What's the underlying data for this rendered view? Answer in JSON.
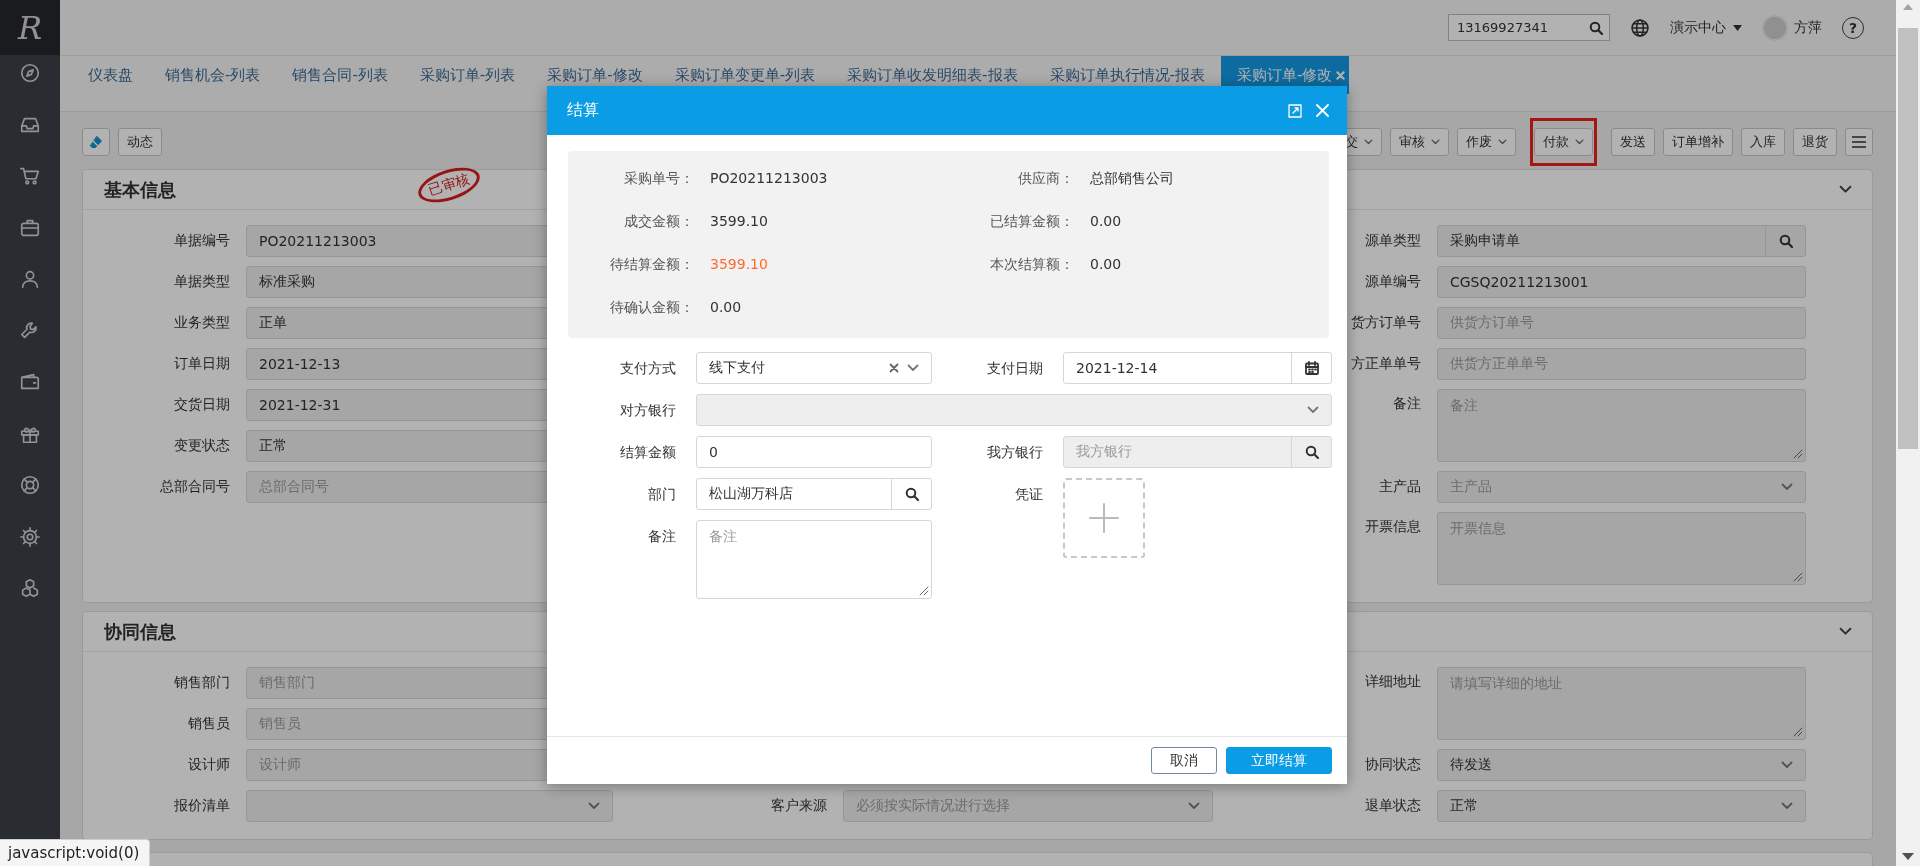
{
  "sidebar": {
    "logo": "R"
  },
  "top_bar": {
    "search": {
      "value": "13169927341"
    },
    "organization": "演示中心",
    "user_name": "方萍",
    "help": "?"
  },
  "tabs": [
    {
      "label": "仪表盘",
      "selected": false
    },
    {
      "label": "销售机会-列表",
      "selected": false
    },
    {
      "label": "销售合同-列表",
      "selected": false
    },
    {
      "label": "采购订单-列表",
      "selected": false
    },
    {
      "label": "采购订单-修改",
      "selected": false
    },
    {
      "label": "采购订单变更单-列表",
      "selected": false
    },
    {
      "label": "采购订单收发明细表-报表",
      "selected": false
    },
    {
      "label": "采购订单执行情况-报表",
      "selected": false
    },
    {
      "label": "采购订单-修改",
      "selected": true
    }
  ],
  "toolbar": {
    "left_buttons": [
      {
        "kind": "icon"
      },
      {
        "kind": "text",
        "label": "动态"
      }
    ],
    "right_buttons": [
      {
        "label": "交",
        "dropdown": true,
        "highlighted": false
      },
      {
        "label": "审核",
        "dropdown": true,
        "highlighted": false
      },
      {
        "label": "作废",
        "dropdown": true,
        "highlighted": false
      },
      {
        "label": "付款",
        "dropdown": true,
        "highlighted": true
      },
      {
        "label": "发送",
        "dropdown": false,
        "highlighted": false
      },
      {
        "label": "订单增补",
        "dropdown": false,
        "highlighted": false
      },
      {
        "label": "入库",
        "dropdown": false,
        "highlighted": false
      },
      {
        "label": "退货",
        "dropdown": false,
        "highlighted": false
      }
    ]
  },
  "basic_info": {
    "title": "基本信息",
    "stamp": "已审核",
    "left_fields": [
      {
        "label": "单据编号",
        "kind": "text",
        "value": "PO20211213003"
      },
      {
        "label": "单据类型",
        "kind": "text",
        "value": "标准采购"
      },
      {
        "label": "业务类型",
        "kind": "text",
        "value": "正单"
      },
      {
        "label": "订单日期",
        "kind": "text",
        "value": "2021-12-13"
      },
      {
        "label": "交货日期",
        "kind": "text",
        "value": "2021-12-31"
      },
      {
        "label": "变更状态",
        "kind": "text",
        "value": "正常"
      },
      {
        "label": "总部合同号",
        "kind": "text",
        "placeholder": "总部合同号"
      }
    ],
    "right_fields": [
      {
        "label": "源单类型",
        "kind": "search",
        "value": "采购申请单"
      },
      {
        "label": "源单编号",
        "kind": "text",
        "value": "CGSQ20211213001"
      },
      {
        "label": "货方订单号",
        "kind": "text",
        "placeholder": "供货方订单号"
      },
      {
        "label": "方正单单号",
        "kind": "text",
        "placeholder": "供货方正单单号"
      },
      {
        "label": "备注",
        "kind": "textarea",
        "placeholder": "备注"
      },
      {
        "label": "主产品",
        "kind": "select",
        "placeholder": "主产品"
      },
      {
        "label": "开票信息",
        "kind": "textarea",
        "placeholder": "开票信息"
      }
    ]
  },
  "collaboration": {
    "title": "协同信息",
    "left_fields": [
      {
        "label": "销售部门",
        "kind": "text",
        "placeholder": "销售部门"
      },
      {
        "label": "销售员",
        "kind": "text",
        "placeholder": "销售员"
      },
      {
        "label": "设计师",
        "kind": "text",
        "placeholder": "设计师"
      },
      {
        "label": "报价清单",
        "kind": "select"
      }
    ],
    "middle_fields": [
      {
        "label": "客户来源",
        "kind": "select",
        "placeholder": "必须按实际情况进行选择"
      }
    ],
    "right_fields": [
      {
        "label": "详细地址",
        "kind": "textarea",
        "placeholder": "请填写详细的地址"
      },
      {
        "label": "协同状态",
        "kind": "select",
        "value": "待发送"
      },
      {
        "label": "退单状态",
        "kind": "select",
        "value": "正常"
      }
    ]
  },
  "dialog": {
    "title": "结算",
    "summary": [
      {
        "label": "采购单号：",
        "value": "PO20211213003",
        "highlight": false
      },
      {
        "label": "供应商：",
        "value": "总部销售公司",
        "highlight": false
      },
      {
        "label": "成交金额：",
        "value": "3599.10",
        "highlight": false
      },
      {
        "label": "已结算金额：",
        "value": "0.00",
        "highlight": false
      },
      {
        "label": "待结算金额：",
        "value": "3599.10",
        "highlight": true
      },
      {
        "label": "本次结算额：",
        "value": "0.00",
        "highlight": false
      },
      {
        "label": "待确认金额：",
        "value": "0.00",
        "highlight": false
      }
    ],
    "form": [
      {
        "label": "支付方式",
        "kind": "select",
        "value": "线下支付",
        "clearable": true,
        "disabled": false
      },
      {
        "label": "支付日期",
        "kind": "date",
        "value": "2021-12-14",
        "disabled": false
      },
      {
        "label": "对方银行",
        "kind": "select",
        "wide": true,
        "disabled": true
      },
      {
        "label": "结算金额",
        "kind": "text",
        "value": "0",
        "disabled": false
      },
      {
        "label": "我方银行",
        "kind": "search",
        "placeholder": "我方银行",
        "disabled": true
      },
      {
        "label": "部门",
        "kind": "search",
        "value": "松山湖万科店",
        "disabled": false
      },
      {
        "label": "凭证",
        "kind": "upload",
        "disabled": false
      },
      {
        "label": "备注",
        "kind": "textarea",
        "placeholder": "备注",
        "disabled": false
      }
    ],
    "buttons": [
      {
        "label": "取消",
        "primary": false
      },
      {
        "label": "立即结算",
        "primary": true
      }
    ]
  },
  "status_bar": {
    "text": "javascript:void(0)"
  }
}
